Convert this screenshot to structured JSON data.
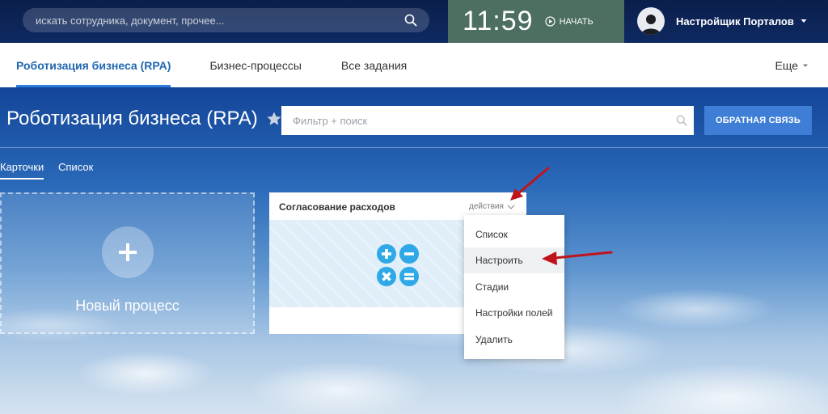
{
  "topbar": {
    "search_placeholder": "искать сотрудника, документ, прочее...",
    "clock_time": "11:59",
    "start_label": "НАЧАТЬ",
    "user_name": "Настройщик Порталов"
  },
  "nav": {
    "items": [
      "Роботизация бизнеса (RPA)",
      "Бизнес-процессы",
      "Все задания"
    ],
    "more_label": "Еще"
  },
  "page": {
    "title": "Роботизация бизнеса (RPA)",
    "filter_placeholder": "Фильтр + поиск",
    "feedback_label": "ОБРАТНАЯ СВЯЗЬ"
  },
  "view_tabs": [
    "Карточки",
    "Список"
  ],
  "new_process": {
    "label": "Новый процесс"
  },
  "process_card": {
    "title": "Согласование расходов",
    "actions_label": "действия"
  },
  "dropdown": {
    "items": [
      "Список",
      "Настроить",
      "Стадии",
      "Настройки полей",
      "Удалить"
    ],
    "hovered_index": 1
  },
  "colors": {
    "accent": "#2067b0",
    "button": "#3e7ed6",
    "clock_bg": "#4c6f61",
    "annotation_arrow": "#c0141c",
    "calc_icon": "#2ea8e6"
  }
}
